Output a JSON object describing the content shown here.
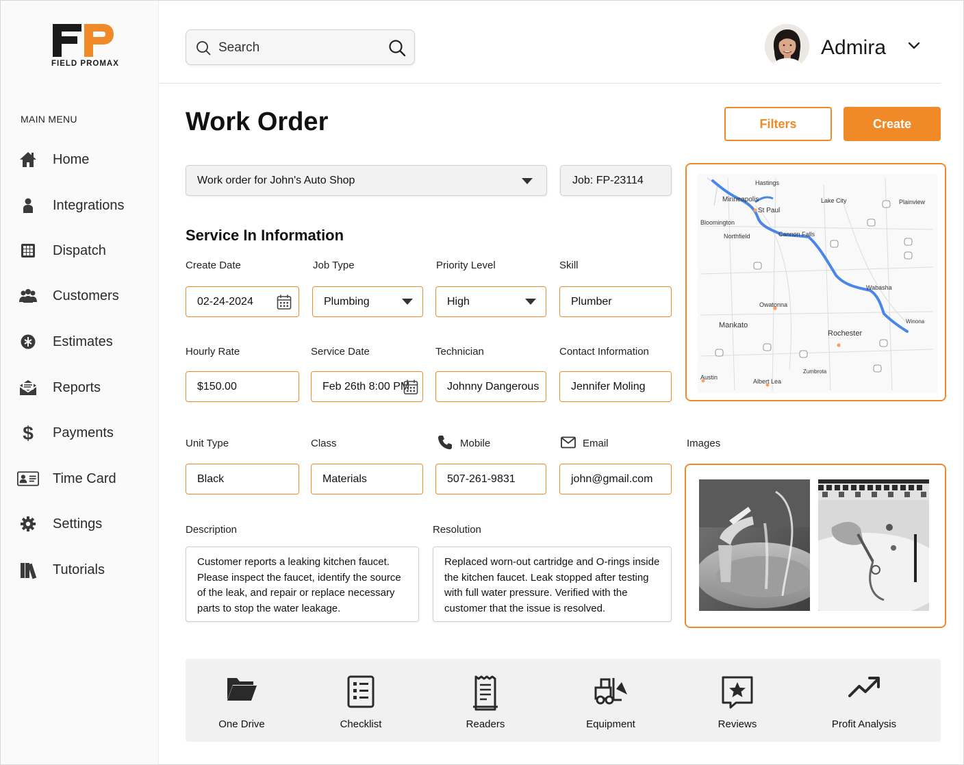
{
  "brand": {
    "logo_text": "FIELD PROMAX",
    "accent": "#f08a28",
    "logo_dark": "#1a1a1a"
  },
  "sidebar": {
    "title": "MAIN MENU",
    "items": [
      {
        "label": "Home",
        "icon": "home-icon"
      },
      {
        "label": "Integrations",
        "icon": "person-icon"
      },
      {
        "label": "Dispatch",
        "icon": "grid-icon"
      },
      {
        "label": "Customers",
        "icon": "group-icon"
      },
      {
        "label": "Estimates",
        "icon": "estimate-icon"
      },
      {
        "label": "Reports",
        "icon": "reports-icon"
      },
      {
        "label": "Payments",
        "icon": "dollar-icon"
      },
      {
        "label": "Time Card",
        "icon": "id-card-icon"
      },
      {
        "label": "Settings",
        "icon": "gear-icon"
      },
      {
        "label": "Tutorials",
        "icon": "books-icon"
      }
    ]
  },
  "header": {
    "search_placeholder": "Search",
    "user_name": "Admira"
  },
  "page": {
    "title": "Work Order",
    "filters_label": "Filters",
    "create_label": "Create",
    "work_order_select": "Work order for John's Auto Shop",
    "job_id": "Job: FP-23114",
    "section_title": "Service In Information"
  },
  "form": {
    "create_date": {
      "label": "Create Date",
      "value": "02-24-2024"
    },
    "job_type": {
      "label": "Job Type",
      "value": "Plumbing"
    },
    "priority": {
      "label": "Priority Level",
      "value": "High"
    },
    "skill": {
      "label": "Skill",
      "value": "Plumber"
    },
    "hourly_rate": {
      "label": "Hourly Rate",
      "value": "$150.00"
    },
    "service_date": {
      "label": "Service Date",
      "value": "Feb 26th 8:00 PM"
    },
    "technician": {
      "label": "Technician",
      "value": "Johnny Dangerous"
    },
    "contact": {
      "label": "Contact Information",
      "value": "Jennifer Moling"
    },
    "unit_type": {
      "label": "Unit Type",
      "value": "Black"
    },
    "class": {
      "label": "Class",
      "value": "Materials"
    },
    "mobile": {
      "label": "Mobile",
      "value": "507-261-9831"
    },
    "email": {
      "label": "Email",
      "value": "john@gmail.com"
    },
    "description": {
      "label": "Description",
      "value": "Customer reports a leaking kitchen faucet. Please inspect the faucet, identify the source of the leak, and repair or replace necessary parts to stop the water leakage."
    },
    "resolution": {
      "label": "Resolution",
      "value": "Replaced worn-out cartridge and O-rings inside the kitchen faucet. Leak stopped after testing with full water pressure. Verified with the customer that the issue is resolved."
    },
    "images_label": "Images"
  },
  "map": {
    "places": [
      "Minneapolis",
      "St Paul",
      "Bloomington",
      "Northfield",
      "Cannon Falls",
      "Lake City",
      "Wabasha",
      "Owatonna",
      "Mankato",
      "Rochester",
      "Albert Lea",
      "Austin",
      "Zumbrota",
      "Winona",
      "Plainview",
      "Hastings"
    ]
  },
  "tools": [
    {
      "label": "One Drive",
      "icon": "folder-icon"
    },
    {
      "label": "Checklist",
      "icon": "checklist-icon"
    },
    {
      "label": "Readers",
      "icon": "receipt-icon"
    },
    {
      "label": "Equipment",
      "icon": "forklift-icon"
    },
    {
      "label": "Reviews",
      "icon": "star-frame-icon"
    },
    {
      "label": "Profit Analysis",
      "icon": "trend-up-icon"
    }
  ]
}
